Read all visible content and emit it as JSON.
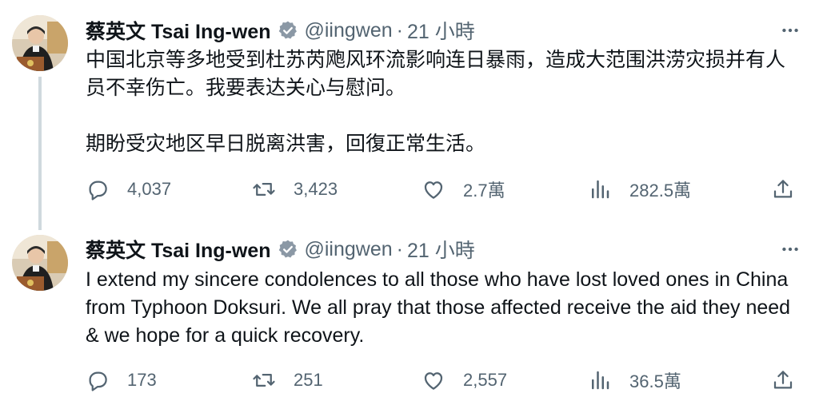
{
  "tweets": [
    {
      "author": {
        "name": "蔡英文 Tsai Ing-wen",
        "handle": "@iingwen"
      },
      "separator": "·",
      "time": "21 小時",
      "text": "中国北京等多地受到杜苏芮飑风环流影响连日暴雨，造成大范围洪涝灾损并有人员不幸伤亡。我要表达关心与慰问。\n\n期盼受灾地区早日脱离洪害，回復正常生活。",
      "stats": {
        "replies": "4,037",
        "retweets": "3,423",
        "likes": "2.7萬",
        "views": "282.5萬"
      }
    },
    {
      "author": {
        "name": "蔡英文 Tsai Ing-wen",
        "handle": "@iingwen"
      },
      "separator": "·",
      "time": "21 小時",
      "text": "I extend my sincere condolences to all those who have lost loved ones in China from Typhoon Doksuri. We all pray that those affected receive the aid they need & we hope for a quick recovery.",
      "stats": {
        "replies": "173",
        "retweets": "251",
        "likes": "2,557",
        "views": "36.5萬"
      }
    }
  ],
  "colors": {
    "text": "#0f1419",
    "muted": "#536471",
    "verified": "#8b98a5",
    "thread_line": "#cfd9de"
  },
  "icons": [
    "verified-badge-icon",
    "more-icon",
    "reply-icon",
    "retweet-icon",
    "like-icon",
    "views-icon",
    "share-icon"
  ]
}
